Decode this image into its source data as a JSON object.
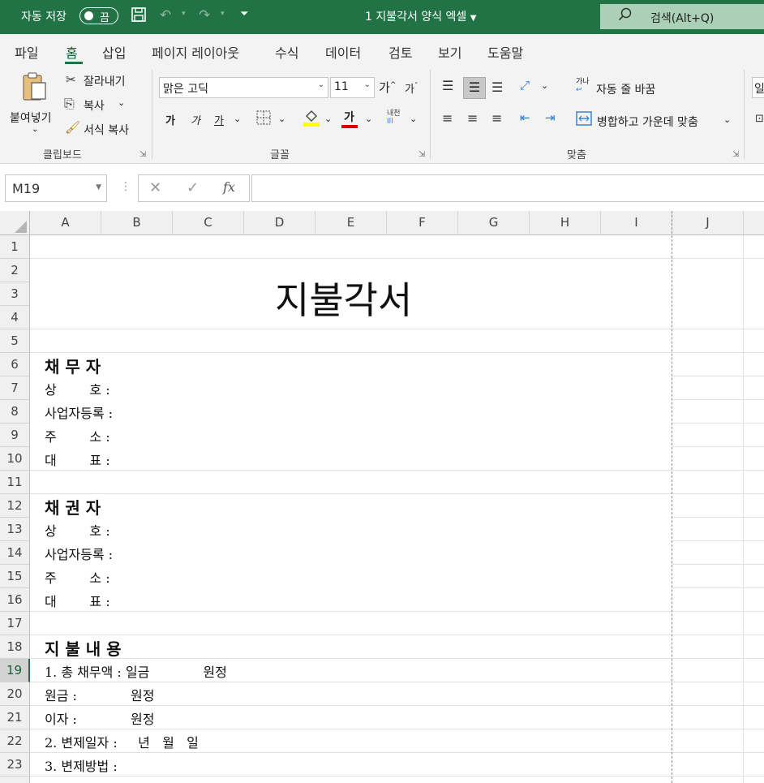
{
  "titlebar": {
    "autosave_label": "자동 저장",
    "toggle_state": "끔",
    "doc_title": "1 지불각서 양식 엑셀",
    "search_label": "검색(Alt+Q)"
  },
  "menu": {
    "items": [
      "파일",
      "홈",
      "삽입",
      "페이지 레이아웃",
      "수식",
      "데이터",
      "검토",
      "보기",
      "도움말"
    ],
    "active": "홈"
  },
  "ribbon": {
    "clipboard": {
      "paste": "붙여넣기",
      "cut": "잘라내기",
      "copy": "복사",
      "format_painter": "서식 복사",
      "group": "클립보드"
    },
    "font": {
      "name": "맑은 고딕",
      "size": "11",
      "grow": "가",
      "shrink": "가",
      "bold": "가",
      "italic": "가",
      "underline": "가",
      "font_color": "가",
      "phonetic": "내천",
      "group": "글꼴"
    },
    "alignment": {
      "wrap_icon": "가나",
      "wrap": "자동 줄 바꿈",
      "merge": "병합하고 가운데 맞춤",
      "group": "맞춤"
    },
    "next_group_stub": "일"
  },
  "formula_bar": {
    "name_box": "M19",
    "fx": "fx",
    "value": ""
  },
  "sheet": {
    "columns": [
      "A",
      "B",
      "C",
      "D",
      "E",
      "F",
      "G",
      "H",
      "I",
      "J"
    ],
    "rows": [
      "1",
      "2",
      "3",
      "4",
      "5",
      "6",
      "7",
      "8",
      "9",
      "10",
      "11",
      "12",
      "13",
      "14",
      "15",
      "16",
      "17",
      "18",
      "19",
      "20",
      "21",
      "22",
      "23"
    ],
    "selected_row": "19",
    "cells": {
      "title": "지불각서",
      "debtor_header": "채 무 자",
      "debtor_company": "상        호 :",
      "debtor_reg": "사업자등록 :",
      "debtor_address": "주        소 :",
      "debtor_rep": "대        표 :",
      "creditor_header": "채 권 자",
      "creditor_company": "상        호 :",
      "creditor_reg": "사업자등록 :",
      "creditor_address": "주        소 :",
      "creditor_rep": "대        표 :",
      "payment_header": "지 불 내 용",
      "total_debt": "1. 총 채무액 : 일금             원정",
      "principal": "원금 :             원정",
      "interest": "이자 :             원정",
      "repay_date": "2. 변제일자 :     년   월   일",
      "repay_method": "3. 변제방법 :"
    }
  }
}
